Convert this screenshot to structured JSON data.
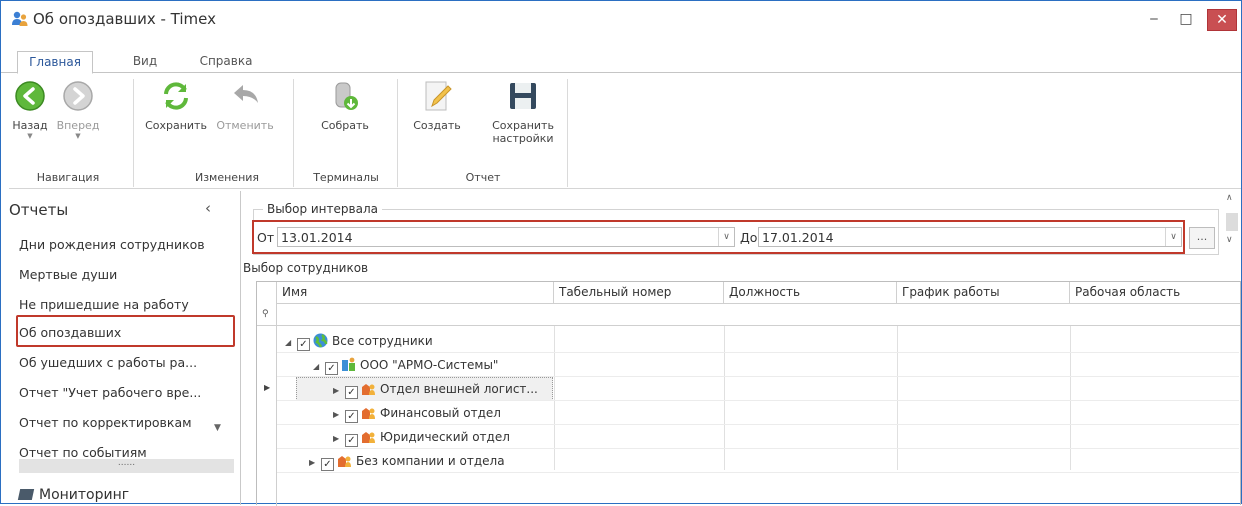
{
  "window": {
    "title": "Об опоздавших - Timex",
    "controls": {
      "minimize": "‒",
      "maximize": "□",
      "close": "✕"
    }
  },
  "ribbon": {
    "tabs": [
      "Главная",
      "Вид",
      "Справка"
    ],
    "buttons": {
      "back": "Назад",
      "forward": "Вперед",
      "save": "Сохранить",
      "cancel": "Отменить",
      "collect": "Собрать",
      "create": "Создать",
      "save_settings_line1": "Сохранить",
      "save_settings_line2": "настройки"
    },
    "groups": [
      "Навигация",
      "Изменения",
      "Терминалы",
      "Отчет"
    ]
  },
  "left_panel": {
    "title": "Отчеты",
    "items": [
      "Дни рождения сотрудников",
      "Мертвые души",
      "Не пришедшие на работу",
      "Об опоздавших",
      "Об ушедших с работы ра...",
      "Отчет \"Учет рабочего вре...",
      "Отчет по корректировкам",
      "Отчет по событиям"
    ],
    "selected_index": 3,
    "grip": "......",
    "monitoring": "Мониторинг"
  },
  "interval": {
    "legend": "Выбор интервала",
    "from_label": "От",
    "from_value": "13.01.2014",
    "to_label": "До",
    "to_value": "17.01.2014",
    "ellipsis": "..."
  },
  "employees": {
    "label": "Выбор сотрудников",
    "columns": [
      "Имя",
      "Табельный номер",
      "Должность",
      "График работы",
      "Рабочая область"
    ],
    "tree": [
      {
        "label": "Все сотрудники",
        "checked": true,
        "icon": "globe-icon"
      },
      {
        "label": "ООО \"АРМО-Системы\"",
        "checked": true,
        "icon": "company-icon"
      },
      {
        "label": "Отдел внешней логист...",
        "checked": true,
        "icon": "department-icon"
      },
      {
        "label": "Финансовый отдел",
        "checked": true,
        "icon": "department-icon"
      },
      {
        "label": "Юридический отдел",
        "checked": true,
        "icon": "department-icon"
      },
      {
        "label": "Без компании и отдела",
        "checked": true,
        "icon": "department-icon"
      }
    ],
    "check_glyph": "✓"
  }
}
